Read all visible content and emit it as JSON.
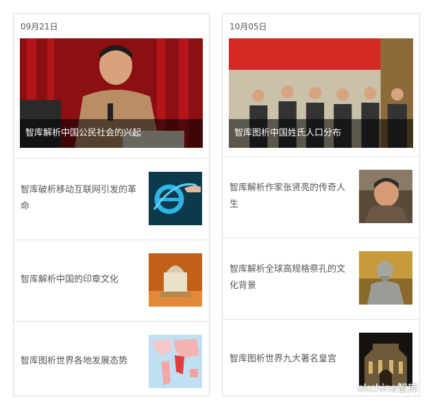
{
  "left": {
    "date": "09月21日",
    "hero_caption": "智库解析中国公民社会的兴起",
    "items": [
      {
        "title": "智库破析移动互联网引发的革命",
        "thumb_icon": "internet-explorer-logo"
      },
      {
        "title": "智库解析中国的印章文化",
        "thumb_icon": "seal-photo"
      },
      {
        "title": "智库图析世界各地发展态势",
        "thumb_icon": "world-map"
      }
    ]
  },
  "right": {
    "date": "10月05日",
    "hero_caption": "智库图析中国姓氏人口分布",
    "items": [
      {
        "title": "智库解析作家张贤亮的传奇人生",
        "thumb_icon": "portrait-photo"
      },
      {
        "title": "智库解析全球高规格祭孔的文化背景",
        "thumb_icon": "confucius-statue"
      },
      {
        "title": "智库图析世界九大著名皇宫",
        "thumb_icon": "palace-night"
      }
    ]
  },
  "watermark": {
    "text": "okchina智库"
  }
}
